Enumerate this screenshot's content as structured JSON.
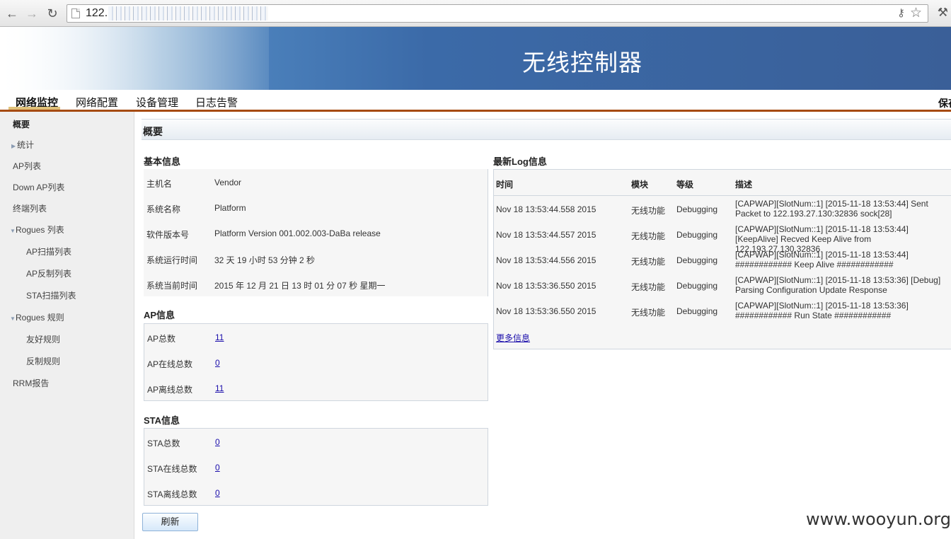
{
  "browser": {
    "url_visible": "122.",
    "icons": [
      "back-icon",
      "forward-icon",
      "reload-icon",
      "page-icon",
      "key-icon",
      "star-icon",
      "wrench-icon"
    ]
  },
  "banner": {
    "title": "无线控制器"
  },
  "topnav": {
    "items": [
      "网络监控",
      "网络配置",
      "设备管理",
      "日志告警"
    ],
    "active": "网络监控",
    "right_text": "保存"
  },
  "sidebar": {
    "items": [
      "概要",
      "统计",
      "AP列表",
      "Down AP列表",
      "终端列表",
      "Rogues 列表",
      "AP扫描列表",
      "AP反制列表",
      "STA扫描列表",
      "Rogues 规则",
      "友好规则",
      "反制规则",
      "RRM报告"
    ]
  },
  "content": {
    "header": "概要",
    "basic": {
      "title": "基本信息",
      "rows": [
        {
          "label": "主机名",
          "value": "Vendor"
        },
        {
          "label": "系统名称",
          "value": "Platform"
        },
        {
          "label": "软件版本号",
          "value": "Platform Version 001.002.003-DaBa release"
        },
        {
          "label": "系统运行时间",
          "value": "32 天 19 小时 53 分钟 2 秒"
        },
        {
          "label": "系统当前时间",
          "value": "2015 年 12 月 21 日 13 时 01 分 07 秒 星期一"
        }
      ]
    },
    "ap": {
      "title": "AP信息",
      "rows": [
        {
          "label": "AP总数",
          "value": "11"
        },
        {
          "label": "AP在线总数",
          "value": "0"
        },
        {
          "label": "AP离线总数",
          "value": "11"
        }
      ]
    },
    "sta": {
      "title": "STA信息",
      "rows": [
        {
          "label": "STA总数",
          "value": "0"
        },
        {
          "label": "STA在线总数",
          "value": "0"
        },
        {
          "label": "STA离线总数",
          "value": "0"
        }
      ]
    },
    "log": {
      "title": "最新Log信息",
      "headers": [
        "时间",
        "模块",
        "等级",
        "描述"
      ],
      "rows": [
        {
          "time": "Nov 18 13:53:44.558 2015",
          "module": "无线功能",
          "level": "Debugging",
          "desc": "[CAPWAP][SlotNum::1] [2015-11-18 13:53:44] Sent Packet to 122.193.27.130:32836 sock[28]"
        },
        {
          "time": "Nov 18 13:53:44.557 2015",
          "module": "无线功能",
          "level": "Debugging",
          "desc": "[CAPWAP][SlotNum::1] [2015-11-18 13:53:44] [KeepAlive] Recved Keep Alive from 122.193.27.130,32836"
        },
        {
          "time": "Nov 18 13:53:44.556 2015",
          "module": "无线功能",
          "level": "Debugging",
          "desc": "[CAPWAP][SlotNum::1] [2015-11-18 13:53:44] ############ Keep Alive ############"
        },
        {
          "time": "Nov 18 13:53:36.550 2015",
          "module": "无线功能",
          "level": "Debugging",
          "desc": "[CAPWAP][SlotNum::1] [2015-11-18 13:53:36] [Debug] Parsing Configuration Update Response"
        },
        {
          "time": "Nov 18 13:53:36.550 2015",
          "module": "无线功能",
          "level": "Debugging",
          "desc": "[CAPWAP][SlotNum::1] [2015-11-18 13:53:36] ############ Run State ############"
        }
      ],
      "more": "更多信息"
    },
    "refresh": "刷新"
  },
  "watermark": "www.wooyun.org"
}
